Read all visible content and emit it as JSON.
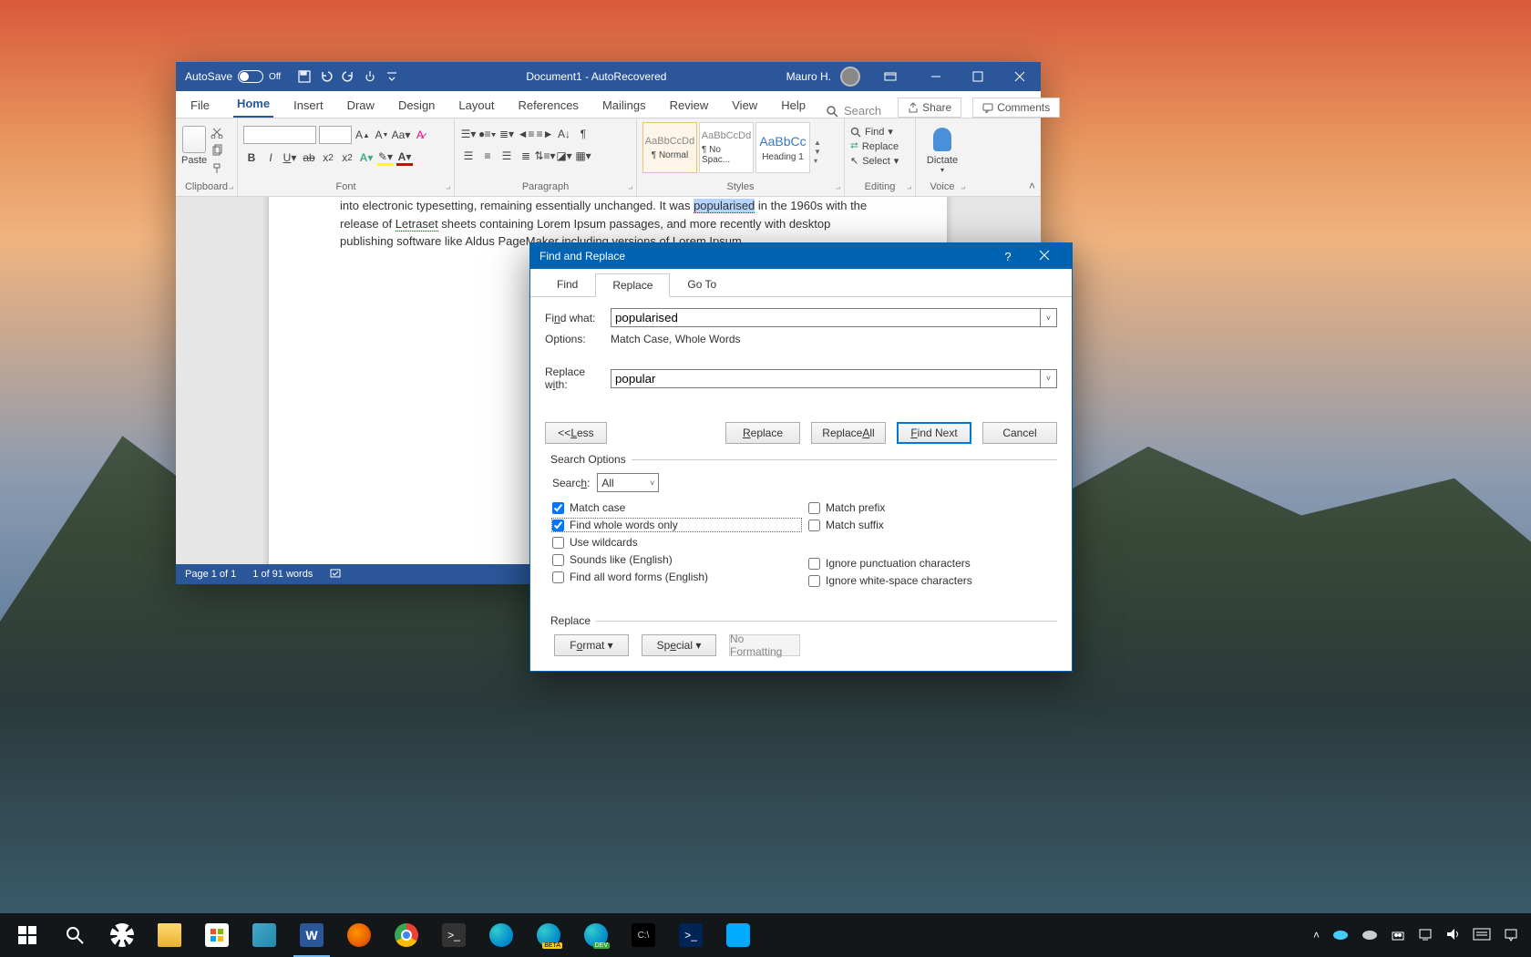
{
  "desktop": {},
  "word": {
    "titlebar": {
      "autosave_label": "AutoSave",
      "autosave_state": "Off",
      "doc_name": "Document1",
      "doc_suffix": "AutoRecovered",
      "user": "Mauro H."
    },
    "tabs": {
      "file": "File",
      "home": "Home",
      "insert": "Insert",
      "draw": "Draw",
      "design": "Design",
      "layout": "Layout",
      "references": "References",
      "mailings": "Mailings",
      "review": "Review",
      "view": "View",
      "help": "Help",
      "search": "Search",
      "share": "Share",
      "comments": "Comments"
    },
    "ribbon": {
      "clipboard": {
        "paste": "Paste",
        "group": "Clipboard"
      },
      "font": {
        "group": "Font"
      },
      "paragraph": {
        "group": "Paragraph"
      },
      "styles": {
        "group": "Styles",
        "items": [
          {
            "preview": "AaBbCcDd",
            "name": "¶ Normal"
          },
          {
            "preview": "AaBbCcDd",
            "name": "¶ No Spac..."
          },
          {
            "preview": "AaBbCc",
            "name": "Heading 1"
          }
        ]
      },
      "editing": {
        "find": "Find",
        "replace": "Replace",
        "select": "Select",
        "group": "Editing"
      },
      "voice": {
        "dictate": "Dictate",
        "group": "Voice"
      }
    },
    "document": {
      "line1a": "into electronic typesetting, remaining essentially unchanged. It was ",
      "highlighted": "popularised",
      "line1b": " in the 1960s with the",
      "line2a": "release of ",
      "spellword": "Letraset",
      "line2b": " sheets containing Lorem Ipsum passages, and more recently with desktop publishing",
      "line3": "software like Aldus PageMaker including versions of Lorem Ipsum."
    },
    "statusbar": {
      "page": "Page 1 of 1",
      "words": "1 of 91 words"
    }
  },
  "dialog": {
    "title": "Find and Replace",
    "tabs": {
      "find": "Find",
      "replace": "Replace",
      "goto": "Go To"
    },
    "find_label": "Find what:",
    "find_value": "popularised",
    "options_label": "Options:",
    "options_value": "Match Case, Whole Words",
    "replace_label": "Replace with:",
    "replace_value": "popular",
    "buttons": {
      "less": "Less",
      "replace": "Replace",
      "replace_all": "Replace All",
      "find_next": "Find Next",
      "cancel": "Cancel"
    },
    "search_options_title": "Search Options",
    "search_label": "Search:",
    "search_value": "All",
    "checks_left": [
      {
        "label": "Match case",
        "checked": true,
        "boxed": false
      },
      {
        "label": "Find whole words only",
        "checked": true,
        "boxed": true
      },
      {
        "label": "Use wildcards",
        "checked": false,
        "boxed": false
      },
      {
        "label": "Sounds like (English)",
        "checked": false,
        "boxed": false
      },
      {
        "label": "Find all word forms (English)",
        "checked": false,
        "boxed": false
      }
    ],
    "checks_right": [
      {
        "label": "Match prefix",
        "checked": false
      },
      {
        "label": "Match suffix",
        "checked": false
      },
      {
        "label": "Ignore punctuation characters",
        "checked": false
      },
      {
        "label": "Ignore white-space characters",
        "checked": false
      }
    ],
    "replace_section": "Replace",
    "format_btn": "Format",
    "special_btn": "Special",
    "noformat_btn": "No Formatting"
  },
  "taskbar": {
    "time": "",
    "date": ""
  }
}
